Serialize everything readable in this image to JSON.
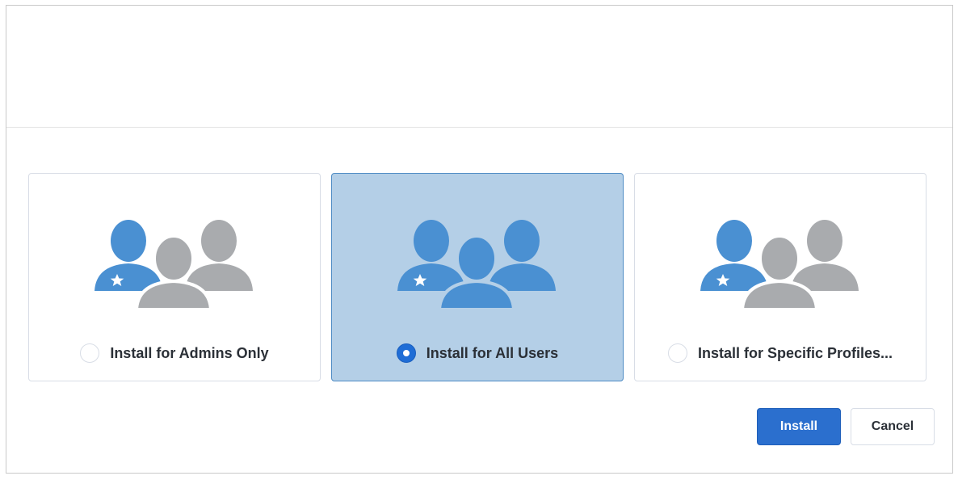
{
  "options": [
    {
      "label": "Install for Admins Only",
      "selected": false,
      "icon": "users-admin-highlighted-icon"
    },
    {
      "label": "Install for All Users",
      "selected": true,
      "icon": "users-all-highlighted-icon"
    },
    {
      "label": "Install for Specific Profiles...",
      "selected": false,
      "icon": "users-admin-highlighted-icon"
    }
  ],
  "buttons": {
    "install_label": "Install",
    "cancel_label": "Cancel"
  },
  "colors": {
    "highlight_user": "#4a90d2",
    "muted_user": "#a9abae",
    "selected_card": "#b4cfe7",
    "primary_button": "#2b6fce"
  }
}
